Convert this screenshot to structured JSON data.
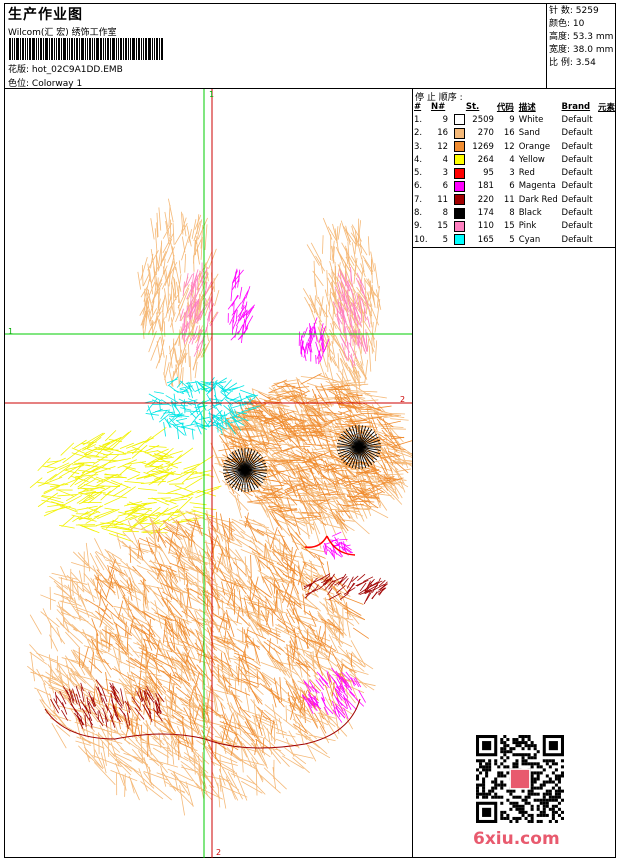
{
  "header": {
    "title": "生产作业图",
    "company": "Wilcom(汇 宏) 绣饰工作室",
    "file_label": "花版:",
    "file_name": "hot_02C9A1DD.EMB",
    "colorway_label": "色位:",
    "colorway_name": "Colorway 1"
  },
  "specs": [
    {
      "label": "针 数:",
      "value": "5259"
    },
    {
      "label": "颜色:",
      "value": "10"
    },
    {
      "label": "高度:",
      "value": "53.3 mm"
    },
    {
      "label": "宽度:",
      "value": "38.0 mm"
    },
    {
      "label": "比 例:",
      "value": "3.54"
    }
  ],
  "stop_sequence_title": "停 止 顺序 :",
  "table_headers": {
    "idx": "#",
    "n": "N#",
    "st": "St.",
    "code": "代码",
    "desc": "描述",
    "brand": "Brand",
    "element": "元素"
  },
  "colors": [
    {
      "idx": "1.",
      "n": "9",
      "hex": "#ffffff",
      "st": "2509",
      "code": "9",
      "desc": "White",
      "brand": "Default"
    },
    {
      "idx": "2.",
      "n": "16",
      "hex": "#f5b978",
      "st": "270",
      "code": "16",
      "desc": "Sand",
      "brand": "Default"
    },
    {
      "idx": "3.",
      "n": "12",
      "hex": "#f08c30",
      "st": "1269",
      "code": "12",
      "desc": "Orange",
      "brand": "Default"
    },
    {
      "idx": "4.",
      "n": "4",
      "hex": "#ffff00",
      "st": "264",
      "code": "4",
      "desc": "Yellow",
      "brand": "Default"
    },
    {
      "idx": "5.",
      "n": "3",
      "hex": "#ff0000",
      "st": "95",
      "code": "3",
      "desc": "Red",
      "brand": "Default"
    },
    {
      "idx": "6.",
      "n": "6",
      "hex": "#ff00ff",
      "st": "181",
      "code": "6",
      "desc": "Magenta",
      "brand": "Default"
    },
    {
      "idx": "7.",
      "n": "11",
      "hex": "#a00000",
      "st": "220",
      "code": "11",
      "desc": "Dark Red",
      "brand": "Default"
    },
    {
      "idx": "8.",
      "n": "8",
      "hex": "#000000",
      "st": "174",
      "code": "8",
      "desc": "Black",
      "brand": "Default"
    },
    {
      "idx": "9.",
      "n": "15",
      "hex": "#ff80c0",
      "st": "110",
      "code": "15",
      "desc": "Pink",
      "brand": "Default"
    },
    {
      "idx": "10.",
      "n": "5",
      "hex": "#00ffff",
      "st": "165",
      "code": "5",
      "desc": "Cyan",
      "brand": "Default"
    }
  ],
  "guides": {
    "h1": "1",
    "h2": "2",
    "v1_top": "1",
    "v2_bottom": "2"
  },
  "watermark": "6xiu.com"
}
